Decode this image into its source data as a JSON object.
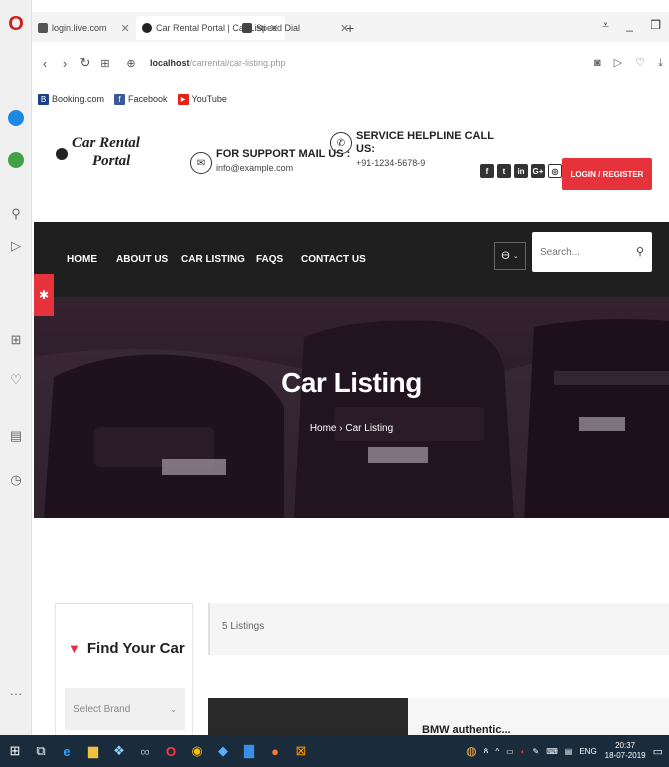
{
  "browser": {
    "tabs": [
      {
        "label": "login.live.com",
        "favicon_color": "#555555"
      },
      {
        "label": "Car Rental Portal | Car Listi",
        "favicon_color": "#222222"
      },
      {
        "label": "Speed Dial",
        "favicon_color": "#444444"
      }
    ],
    "new_tab_icon": "+",
    "address": {
      "host": "localhost",
      "path": "/carrental/car-listing.php"
    },
    "bookmarks": [
      {
        "label": "Booking.com",
        "icon_color": "#1d3f8a",
        "icon_letter": "B"
      },
      {
        "label": "Facebook",
        "icon_color": "#3b5998",
        "icon_letter": "f"
      },
      {
        "label": "YouTube",
        "icon_color": "#e62117",
        "icon_letter": "▶"
      }
    ]
  },
  "site": {
    "logo": {
      "line1": "Car Rental",
      "line2": "Portal"
    },
    "support_mail": {
      "title": "FOR SUPPORT MAIL US :",
      "value": "info@example.com"
    },
    "helpline": {
      "title_line1": "SERVICE HELPLINE CALL",
      "title_line2": "US:",
      "value": "+91-1234-5678-9"
    },
    "social": [
      "f",
      "t",
      "in",
      "G+",
      "◎"
    ],
    "login_label": "LOGIN / REGISTER",
    "nav": [
      "HOME",
      "ABOUT US",
      "CAR LISTING",
      "FAQS",
      "CONTACT US"
    ],
    "search_placeholder": "Search...",
    "banner": {
      "title": "Car Listing",
      "breadcrumb": "Home › Car Listing"
    },
    "filter": {
      "title": "Find Your Car",
      "brand_placeholder": "Select Brand"
    },
    "results": {
      "count_text": "5 Listings",
      "first_listing": "BMW authentic..."
    },
    "accent_color": "#e5323b"
  },
  "taskbar": {
    "language": "ENG",
    "time": "20:37",
    "date": "18-07-2019"
  }
}
